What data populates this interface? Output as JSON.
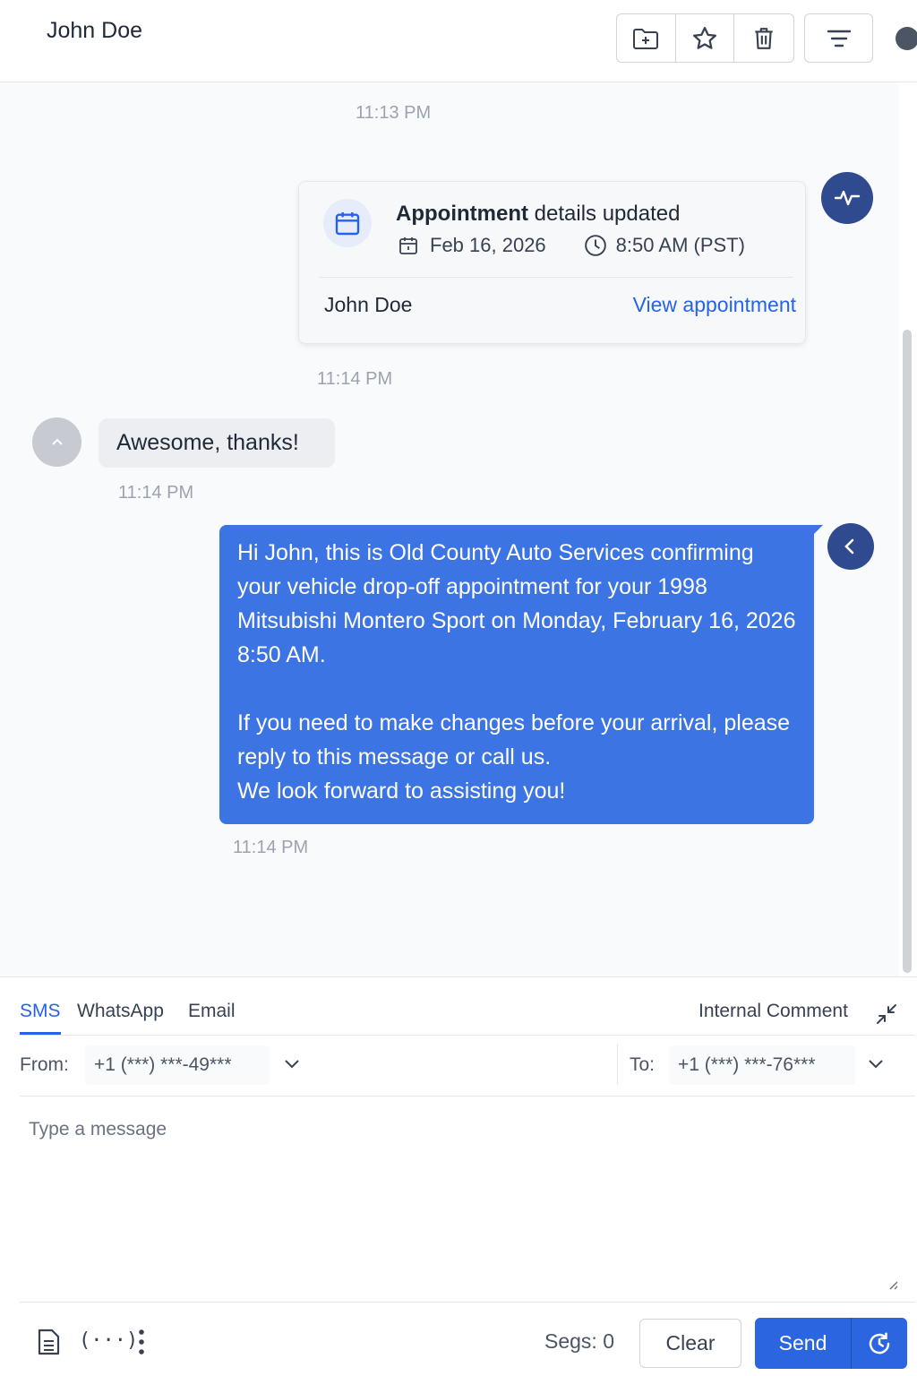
{
  "header": {
    "title": "John Doe",
    "icons": [
      "folder-icon",
      "star-icon",
      "trash-icon",
      "filter-icon",
      "info-icon"
    ]
  },
  "conversation": {
    "time_1": "11:13 PM",
    "appointment_card": {
      "title_bold": "Appointment",
      "title_rest": " details updated",
      "date": "Feb 16, 2026",
      "time": "8:50 AM (PST)",
      "contact": "John Doe",
      "link": "View appointment"
    },
    "time_2": "11:14 PM",
    "incoming_message": "Awesome, thanks!",
    "time_3": "11:14 PM",
    "outgoing_message": {
      "paragraph_1": "Hi John, this is Old County Auto Services confirming your vehicle drop-off appointment for your 1998 Mitsubishi Montero Sport on Monday, February 16, 2026 8:50 AM.",
      "paragraph_2": "If you need to make changes before your arrival, please reply to this message or call us.",
      "paragraph_3": "We look forward to assisting you!"
    },
    "time_4": "11:14 PM"
  },
  "composer": {
    "tabs": [
      "SMS",
      "WhatsApp",
      "Email"
    ],
    "active_tab": "SMS",
    "internal_comment": "Internal Comment",
    "from_label": "From:",
    "from_value": "+1 (***) ***-49***",
    "to_label": "To:",
    "to_value": "+1 (***) ***-76***",
    "message_placeholder": "Type a message",
    "variables_label": "(···)",
    "segments": "Segs: 0",
    "clear_label": "Clear",
    "send_label": "Send"
  },
  "colors": {
    "accent": "#2563eb",
    "outgoing_bubble": "#3c74e3",
    "avatar_dark": "#2f4a8f",
    "incoming_bubble": "#eceef1"
  }
}
